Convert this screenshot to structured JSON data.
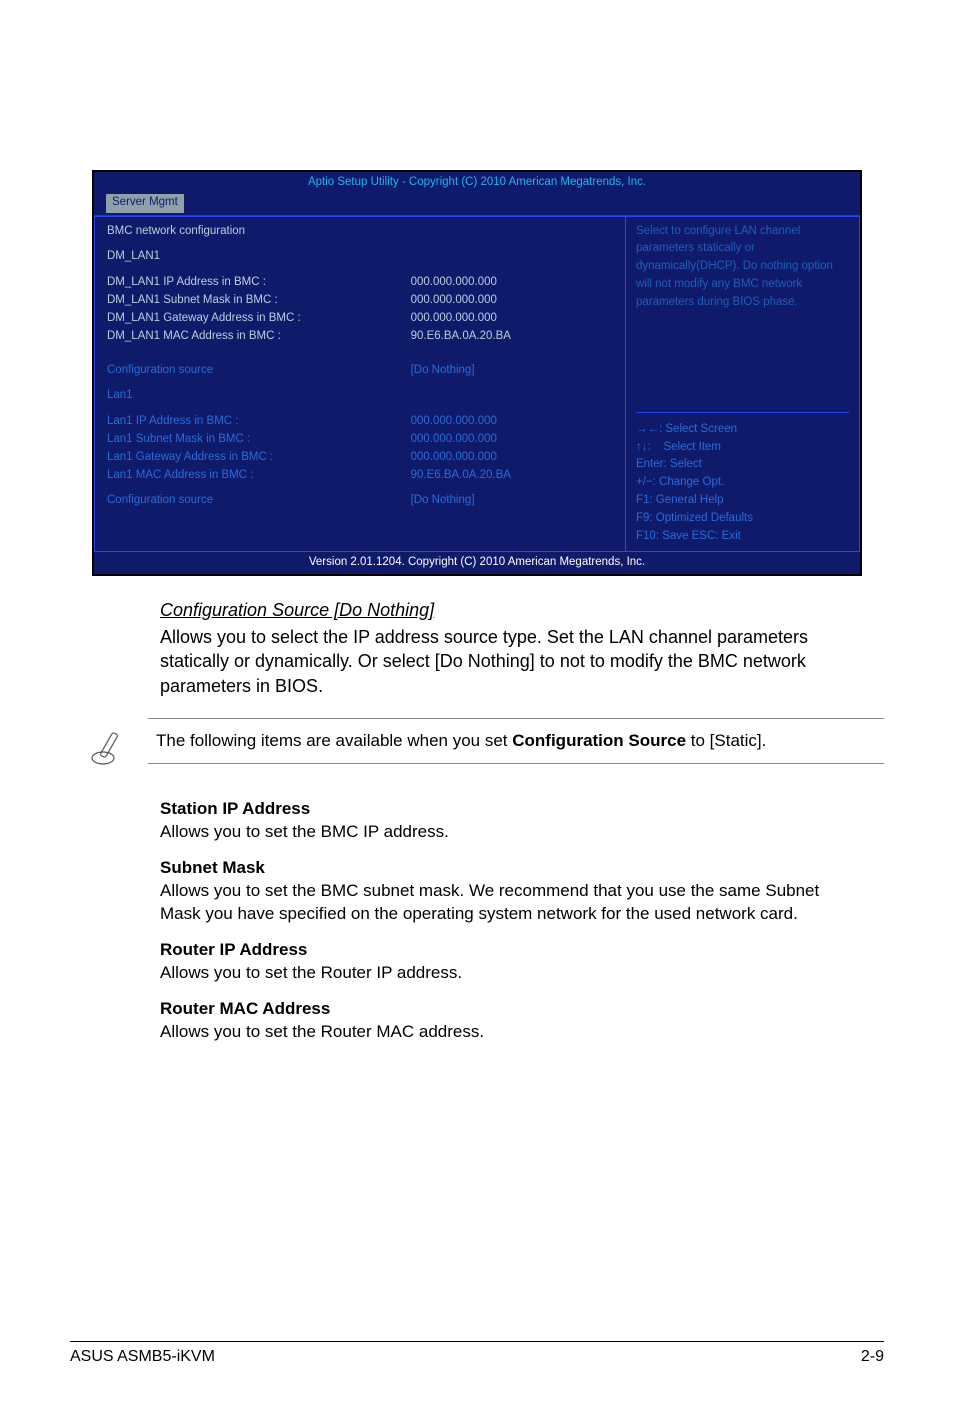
{
  "bios": {
    "header": "Aptio Setup Utility - Copyright (C) 2010 American Megatrends, Inc.",
    "tab": "Server Mgmt",
    "version": "Version 2.01.1204. Copyright (C) 2010 American Megatrends, Inc.",
    "left": {
      "title": "BMC network configuration",
      "group1": "DM_LAN1",
      "rows1": [
        {
          "l": "DM_LAN1 IP Address in BMC :",
          "v": "000.000.000.000"
        },
        {
          "l": "DM_LAN1 Subnet Mask in BMC :",
          "v": "000.000.000.000"
        },
        {
          "l": "DM_LAN1 Gateway Address in BMC :",
          "v": "000.000.000.000"
        },
        {
          "l": "DM_LAN1 MAC Address in BMC :",
          "v": "90.E6.BA.0A.20.BA"
        }
      ],
      "cfg1_l": "Configuration source",
      "cfg1_v": "[Do Nothing]",
      "group2": "Lan1",
      "rows2": [
        {
          "l": "Lan1 IP Address in BMC :",
          "v": "000.000.000.000"
        },
        {
          "l": "Lan1 Subnet Mask in BMC :",
          "v": "000.000.000.000"
        },
        {
          "l": "Lan1 Gateway Address in BMC :",
          "v": "000.000.000.000"
        },
        {
          "l": "Lan1 MAC Address in BMC :",
          "v": "90.E6.BA.0A.20.BA"
        }
      ],
      "cfg2_l": "Configuration source",
      "cfg2_v": "[Do Nothing]"
    },
    "help_text": "Select to configure LAN channel parameters statically or dynamically(DHCP). Do nothing option will not modify any BMC network parameters during BIOS phase.",
    "legend": {
      "a": "Select Screen",
      "b": "Select Item",
      "c": "Enter: Select",
      "d": "+/−:  Change Opt.",
      "e": "F1:     General Help",
      "f": "F9:     Optimized Defaults",
      "g": "F10:   Save    ESC: Exit"
    }
  },
  "doc": {
    "cfg_title": "Configuration Source [Do Nothing]",
    "cfg_body": "Allows you to select the IP address source type. Set the LAN channel parameters statically or dynamically. Or select [Do Nothing] to not to modify the BMC network parameters in BIOS.",
    "note_pre": "The following items are available when you set ",
    "note_bold": "Configuration Source",
    "note_post": " to [Static].",
    "s1_h": "Station IP Address",
    "s1_p": "Allows you to set the BMC IP address.",
    "s2_h": "Subnet Mask",
    "s2_p": "Allows you to set the BMC subnet mask. We recommend that you use the same Subnet Mask you have specified on the operating system network for the used network card.",
    "s3_h": "Router IP Address",
    "s3_p": "Allows you to set the Router IP address.",
    "s4_h": "Router MAC Address",
    "s4_p": "Allows you to set the Router MAC address."
  },
  "footer": {
    "left": "ASUS ASMB5-iKVM",
    "right": "2-9"
  }
}
